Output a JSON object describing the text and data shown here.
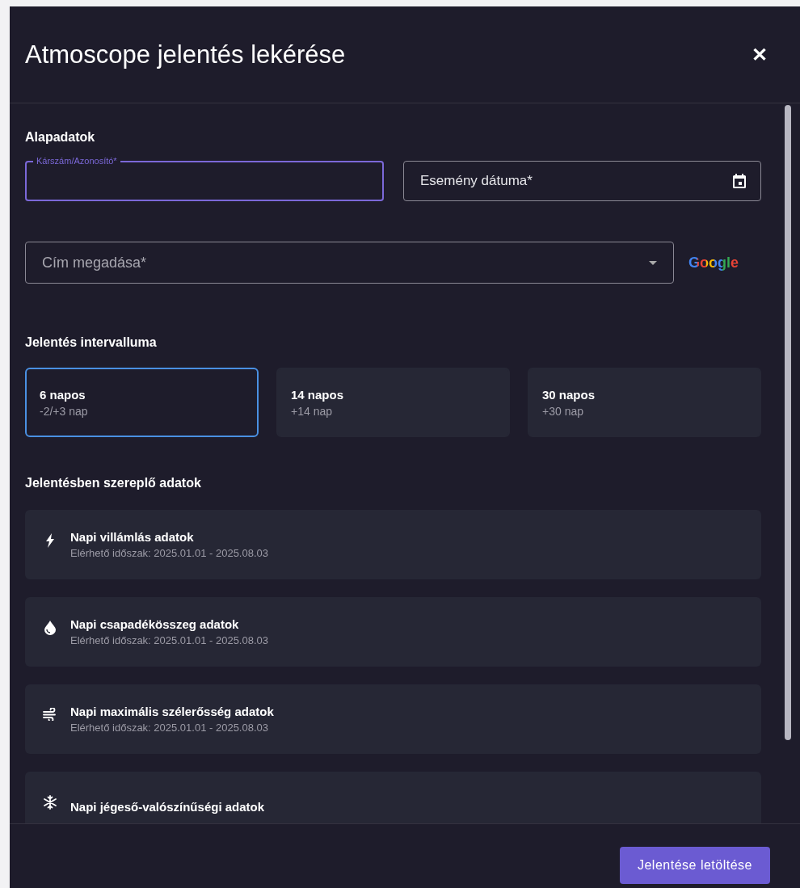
{
  "dialog": {
    "title": "Atmoscope jelentés lekérése",
    "close": "✕"
  },
  "basics": {
    "heading": "Alapadatok",
    "claim_field": {
      "label": "Kárszám/Azonosító*",
      "focused": true
    },
    "date_field": {
      "label": "Esemény dátuma*"
    },
    "address_field": {
      "placeholder": "Cím megadása*"
    },
    "provider": "Google"
  },
  "interval": {
    "heading": "Jelentés intervalluma",
    "options": [
      {
        "title": "6 napos",
        "subtitle": "-2/+3 nap",
        "selected": true
      },
      {
        "title": "14 napos",
        "subtitle": "+14 nap",
        "selected": false
      },
      {
        "title": "30 napos",
        "subtitle": "+30 nap",
        "selected": false
      }
    ]
  },
  "datasets": {
    "heading": "Jelentésben szereplő adatok",
    "items": [
      {
        "kind": "lightning",
        "title": "Napi villámlás adatok",
        "subtitle": "Elérhető időszak: 2025.01.01 - 2025.08.03"
      },
      {
        "kind": "drop",
        "title": "Napi csapadékösszeg adatok",
        "subtitle": "Elérhető időszak: 2025.01.01 - 2025.08.03"
      },
      {
        "kind": "wind",
        "title": "Napi maximális szélerősség adatok",
        "subtitle": "Elérhető időszak: 2025.01.01 - 2025.08.03"
      },
      {
        "kind": "snowflake",
        "title": "Napi jégeső-valószínűségi adatok"
      }
    ]
  },
  "footer": {
    "download_button": "Jelentése letöltése"
  }
}
